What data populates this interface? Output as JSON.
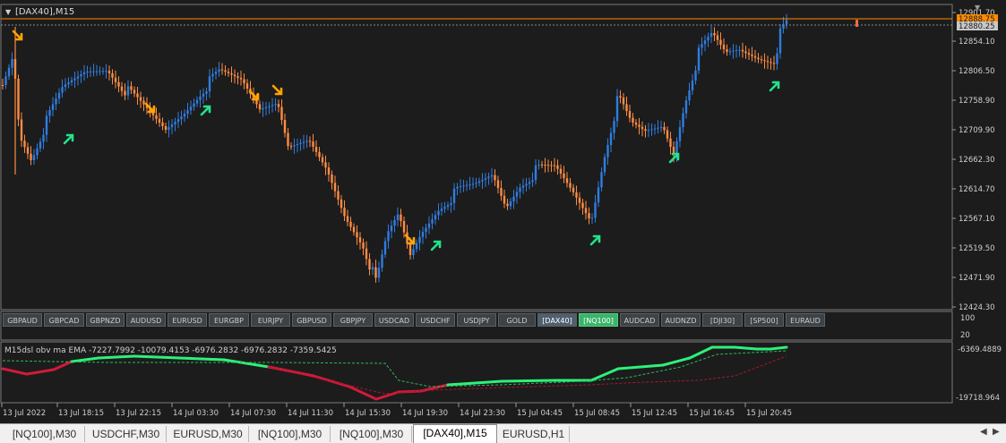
{
  "chart": {
    "title": "[DAX40],M15",
    "price_labels": [
      "12901.70",
      "12854.10",
      "12806.50",
      "12758.90",
      "12709.90",
      "12662.30",
      "12614.70",
      "12567.10",
      "12519.50",
      "12471.90",
      "12424.30"
    ],
    "bid_label": "12880.25",
    "ask_label": "12888.75",
    "colors": {
      "bull": "#2f7de1",
      "bear": "#ff8c42",
      "up_arrow": "#22e38a",
      "down_arrow": "#ffa500",
      "ask_line": "#ff8c00"
    }
  },
  "symbols": [
    {
      "label": "GBPAUD",
      "state": "normal"
    },
    {
      "label": "GBPCAD",
      "state": "normal"
    },
    {
      "label": "GBPNZD",
      "state": "normal"
    },
    {
      "label": "AUDUSD",
      "state": "normal"
    },
    {
      "label": "EURUSD",
      "state": "normal"
    },
    {
      "label": "EURGBP",
      "state": "normal"
    },
    {
      "label": "EURJPY",
      "state": "normal"
    },
    {
      "label": "GBPUSD",
      "state": "normal"
    },
    {
      "label": "GBPJPY",
      "state": "normal"
    },
    {
      "label": "USDCAD",
      "state": "normal"
    },
    {
      "label": "USDCHF",
      "state": "normal"
    },
    {
      "label": "USDJPY",
      "state": "normal"
    },
    {
      "label": "GOLD",
      "state": "normal"
    },
    {
      "label": "[DAX40]",
      "state": "active"
    },
    {
      "label": "[NQ100]",
      "state": "green"
    },
    {
      "label": "AUDCAD",
      "state": "normal"
    },
    {
      "label": "AUDNZD",
      "state": "normal"
    },
    {
      "label": "[DJI30]",
      "state": "normal"
    },
    {
      "label": "[SP500]",
      "state": "normal"
    },
    {
      "label": "EURAUD",
      "state": "normal"
    }
  ],
  "symbol_scale": {
    "top": "100",
    "bottom": "20"
  },
  "indicator": {
    "label": "M15dsl  obv ma  EMA  -7227.7992 -10079.4153 -6976.2832 -6976.2832 -7359.5425",
    "top_value": "-6369.4889",
    "bottom_value": "-19718.964",
    "colors": {
      "up": "#2ef07a",
      "down": "#d11a3a"
    }
  },
  "time_labels": [
    "13 Jul 2022",
    "13 Jul 18:15",
    "13 Jul 22:15",
    "14 Jul 03:30",
    "14 Jul 07:30",
    "14 Jul 11:30",
    "14 Jul 15:30",
    "14 Jul 19:30",
    "14 Jul 23:30",
    "15 Jul 04:45",
    "15 Jul 08:45",
    "15 Jul 12:45",
    "15 Jul 16:45",
    "15 Jul 20:45"
  ],
  "tabs": [
    {
      "label": "[NQ100],M30",
      "active": false
    },
    {
      "label": "USDCHF,M30",
      "active": false
    },
    {
      "label": "EURUSD,M30",
      "active": false
    },
    {
      "label": "[NQ100],M30",
      "active": false
    },
    {
      "label": "[NQ100],M30",
      "active": false
    },
    {
      "label": "[DAX40],M15",
      "active": true
    },
    {
      "label": "EURUSD,H1",
      "active": false
    }
  ]
}
